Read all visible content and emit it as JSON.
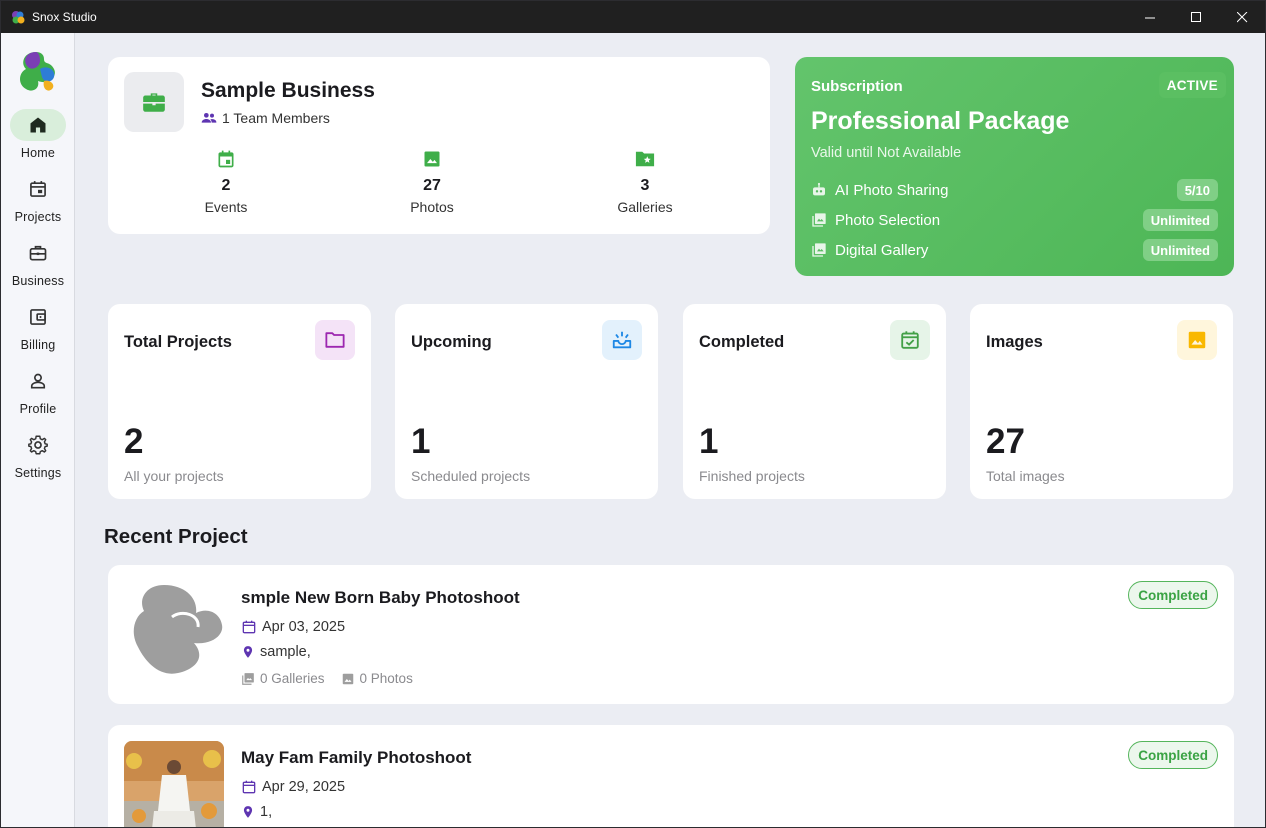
{
  "window": {
    "title": "Snox Studio"
  },
  "sidebar": {
    "items": [
      {
        "label": "Home",
        "icon": "home-icon",
        "active": true
      },
      {
        "label": "Projects",
        "icon": "calendar-icon"
      },
      {
        "label": "Business",
        "icon": "briefcase-icon"
      },
      {
        "label": "Billing",
        "icon": "wallet-icon"
      },
      {
        "label": "Profile",
        "icon": "person-icon"
      },
      {
        "label": "Settings",
        "icon": "gear-icon"
      }
    ]
  },
  "business": {
    "name": "Sample Business",
    "members": "1 Team Members",
    "stats": [
      {
        "value": "2",
        "label": "Events",
        "icon": "event-icon"
      },
      {
        "value": "27",
        "label": "Photos",
        "icon": "image-icon"
      },
      {
        "value": "3",
        "label": "Galleries",
        "icon": "folder-star-icon"
      }
    ]
  },
  "subscription": {
    "label": "Subscription",
    "status": "ACTIVE",
    "plan": "Professional Package",
    "valid": "Valid until Not Available",
    "features": [
      {
        "name": "AI Photo Sharing",
        "value": "5/10",
        "icon": "robot-icon"
      },
      {
        "name": "Photo Selection",
        "value": "Unlimited",
        "icon": "photo-library-icon"
      },
      {
        "name": "Digital Gallery",
        "value": "Unlimited",
        "icon": "photo-library-icon"
      }
    ]
  },
  "stats": [
    {
      "title": "Total Projects",
      "value": "2",
      "caption": "All your projects",
      "icon": "folder-icon",
      "color": "#9c27b0",
      "bg": "#f4e3f7"
    },
    {
      "title": "Upcoming",
      "value": "1",
      "caption": "Scheduled projects",
      "icon": "upcoming-icon",
      "color": "#1e88e5",
      "bg": "#e3f1fc"
    },
    {
      "title": "Completed",
      "value": "1",
      "caption": "Finished projects",
      "icon": "calendar-check-icon",
      "color": "#43a047",
      "bg": "#e6f4e8"
    },
    {
      "title": "Images",
      "value": "27",
      "caption": "Total images",
      "icon": "image-icon",
      "color": "#f9b800",
      "bg": "#fff6dc"
    }
  ],
  "recent": {
    "title": "Recent Project",
    "projects": [
      {
        "name": "smple New Born Baby Photoshoot",
        "date": "Apr 03, 2025",
        "location": "sample,",
        "galleries": "0 Galleries",
        "photos": "0 Photos",
        "status": "Completed"
      },
      {
        "name": "May Fam Family Photoshoot",
        "date": "Apr 29, 2025",
        "location": "1,",
        "status": "Completed"
      }
    ]
  },
  "colors": {
    "accent": "#4caf50",
    "primary_purple": "#5e35b1"
  }
}
